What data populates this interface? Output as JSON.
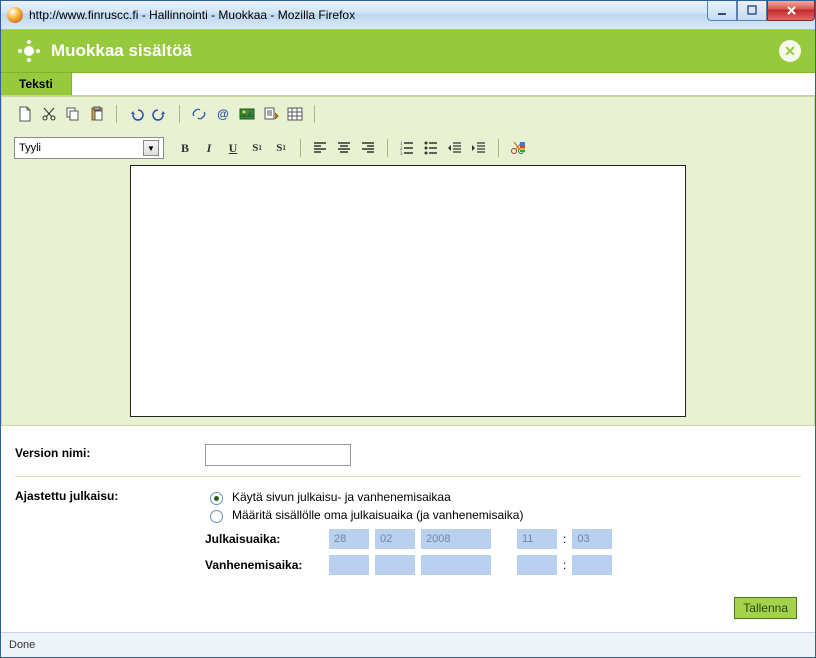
{
  "window_title": "http://www.finruscc.fi - Hallinnointi - Muokkaa - Mozilla Firefox",
  "header_title": "Muokkaa sisältöä",
  "tab_text": "Teksti",
  "style_label": "Tyyli",
  "version_name_label": "Version nimi:",
  "version_name_value": "",
  "scheduled_label": "Ajastettu julkaisu:",
  "radio1_label": "Käytä sivun julkaisu- ja vanhenemisaikaa",
  "radio2_label": "Määritä sisällölle oma julkaisuaika (ja vanhenemisaika)",
  "publish_label": "Julkaisuaika:",
  "expire_label": "Vanhenemisaika:",
  "publish": {
    "d": "28",
    "m": "02",
    "y": "2008",
    "h": "11",
    "min": "03"
  },
  "expire": {
    "d": "",
    "m": "",
    "y": "",
    "h": "",
    "min": ""
  },
  "time_sep": ":",
  "save_label": "Tallenna",
  "status_text": "Done"
}
